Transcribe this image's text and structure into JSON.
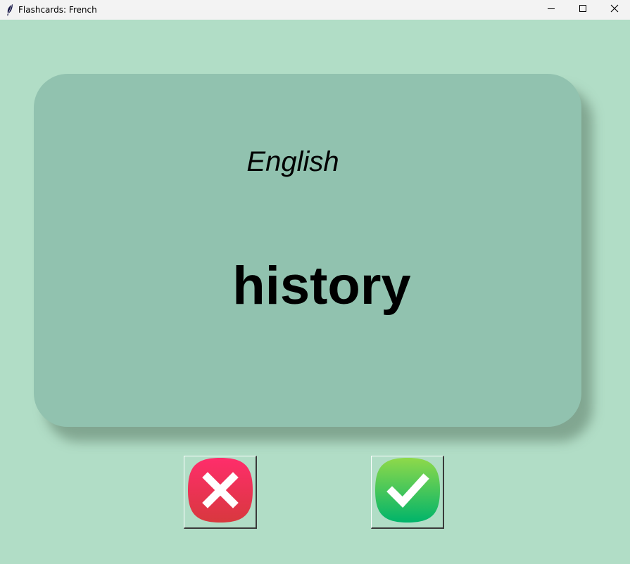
{
  "window": {
    "title": "Flashcards: French",
    "icons": {
      "app": "feather-icon",
      "minimize": "minimize-icon",
      "maximize": "maximize-icon",
      "close": "close-icon"
    },
    "background_color": "#b1ddc6"
  },
  "card": {
    "language": "English",
    "word": "history",
    "color": "#91c2af"
  },
  "buttons": {
    "wrong": {
      "icon": "cross-icon",
      "color_top": "#ff2d6b",
      "color_bottom": "#d8383e"
    },
    "right": {
      "icon": "checkmark-icon",
      "color_top": "#8fd94a",
      "color_bottom": "#00b46a"
    }
  }
}
